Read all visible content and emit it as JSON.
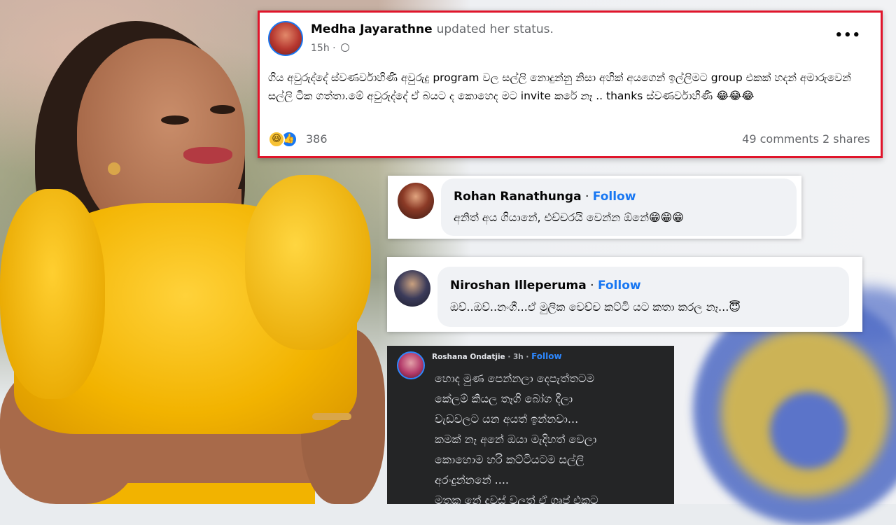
{
  "post": {
    "author": "Medha Jayarathne",
    "action": "updated her status.",
    "time": "15h",
    "privacy_icon": "globe-icon",
    "more_icon": "•••",
    "body": "ගිය අවුරුද්දේ ස්වණර්වාහිණි අවුරුදු program වල සල්ලි නොදුන්නු නිසා අහික්  අයගෙන් ඉල්ලිමට group එකක් හදන් අමාරුවෙන් සල්ලි ටික ගත්තා.මේ අවුරුද්දේ ඒ බයට ද කොහෙද මට invite කරේ නෑ .. thanks ස්වණර්වාහිණි 😂😂😂",
    "reactions": {
      "icons": [
        "haha",
        "like"
      ],
      "haha_glyph": "😆",
      "like_glyph": "👍",
      "count": "386"
    },
    "stats": "49 comments  2 shares",
    "highlight_color": "#e0152b"
  },
  "comments": [
    {
      "author": "Rohan Ranathunga",
      "separator": " · ",
      "follow": "Follow",
      "text": "අනිත් අය ගියානේ, එච්චරයි වෙන්න ඕනේ😁😁😁"
    },
    {
      "author": "Niroshan Illeperuma",
      "separator": " · ",
      "follow": "Follow",
      "text": "ඔව්..ඔව්..නංගී...ඒ මුලික වෙච්ච කට්ටි යට කතා කරල නෑ...😇"
    }
  ],
  "dark_comment": {
    "author": "Roshana Ondatjie",
    "time": " · 3h · ",
    "follow": "Follow",
    "lines": [
      "හොද මුණ පෙන්නලා දෙපැත්තටම",
      "කේලම් කියල තෑගි බෝග දීලා",
      "වැඩවලට යන අයත් ඉන්නවා...",
      "කමක් නෑ අනේ ඔයා මැදිහත් වෙලා",
      "කොහොම හරි කට්ටියටම සල්ලි",
      "අරංදුන්නනේ ....",
      "මතක නේ දවස් වලත් ඒ ගෘප් එකට"
    ]
  },
  "colors": {
    "facebook_blue": "#1877f2",
    "follow_blue": "#1877f2",
    "dark_bg": "#242526",
    "top_yellow": "#f2b300",
    "emblem_blue": "#4f6bc4",
    "emblem_gold": "#e6c13a"
  }
}
